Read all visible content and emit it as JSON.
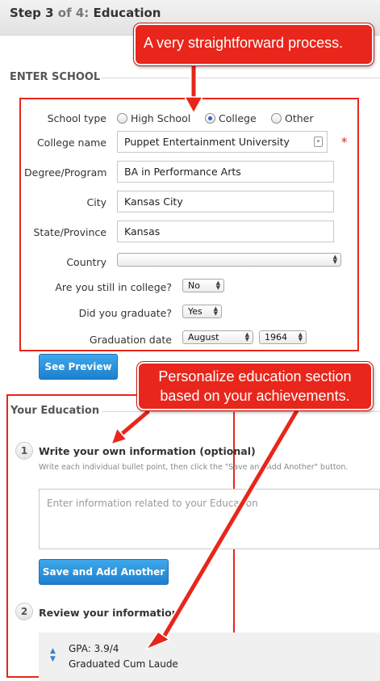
{
  "header": {
    "step_prefix": "Step 3",
    "step_of": "of 4:",
    "step_title": "Education"
  },
  "enter_school": {
    "heading": "ENTER SCHOOL",
    "school_type_label": "School type",
    "school_type_options": [
      "High School",
      "College",
      "Other"
    ],
    "school_type_selected": "College",
    "college_name_label": "College name",
    "college_name_value": "Puppet Entertainment University",
    "degree_label": "Degree/Program",
    "degree_value": "BA in Performance Arts",
    "city_label": "City",
    "city_value": "Kansas City",
    "state_label": "State/Province",
    "state_value": "Kansas",
    "country_label": "Country",
    "country_value": "",
    "still_label": "Are you still in college?",
    "still_value": "No",
    "graduate_label": "Did you graduate?",
    "graduate_value": "Yes",
    "grad_date_label": "Graduation date",
    "grad_month": "August",
    "grad_year": "1964",
    "required_mark": "*"
  },
  "see_preview_label": "See Preview",
  "your_education": {
    "heading": "Your Education",
    "step1_number": "1",
    "step1_title": "Write your own information (optional)",
    "step1_hint": "Write each individual bullet point, then click the \"Save and Add Another\" button.",
    "textarea_placeholder": "Enter information related to your Education",
    "save_label": "Save and Add Another",
    "step2_number": "2",
    "step2_title": "Review your information",
    "review_items": [
      "GPA: 3.9/4",
      "Graduated Cum Laude"
    ]
  },
  "callouts": {
    "top": "A very straightforward process.",
    "middle_line1": "Personalize education section",
    "middle_line2": "based on your achievements."
  },
  "colors": {
    "annotation_red": "#e8261b",
    "button_blue": "#1d80cf",
    "radio_blue": "#2b62c9"
  }
}
